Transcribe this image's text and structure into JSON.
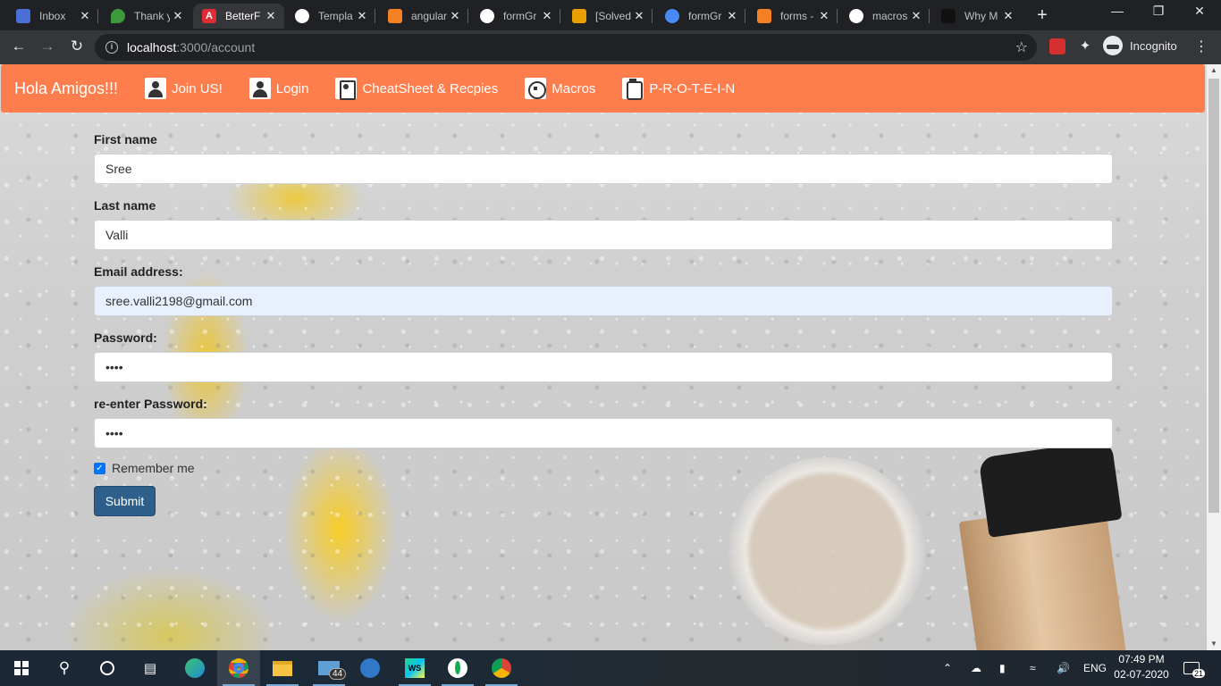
{
  "browser": {
    "tabs": [
      {
        "label": "Inbox",
        "color": "#4a6fd6"
      },
      {
        "label": "Thank y",
        "color": "#3c9a3c"
      },
      {
        "label": "BetterF",
        "color": "#dd2c35",
        "active": true
      },
      {
        "label": "Templa",
        "color": "#ffffff"
      },
      {
        "label": "angular",
        "color": "#f48024"
      },
      {
        "label": "formGr",
        "color": "#ffffff"
      },
      {
        "label": "[Solved",
        "color": "#e8a000"
      },
      {
        "label": "formGr",
        "color": "#4a8af4"
      },
      {
        "label": "forms -",
        "color": "#f48024"
      },
      {
        "label": "macros",
        "color": "#ffffff"
      },
      {
        "label": "Why M",
        "color": "#111111"
      }
    ],
    "url_host": "localhost",
    "url_path": ":3000/account",
    "incognito_label": "Incognito"
  },
  "navbar": {
    "brand": "Hola Amigos!!!",
    "items": [
      {
        "label": "Join US!",
        "icon": "user-icon"
      },
      {
        "label": "Login",
        "icon": "user-icon"
      },
      {
        "label": "CheatSheet & Recpies",
        "icon": "book-icon"
      },
      {
        "label": "Macros",
        "icon": "calculator-icon"
      },
      {
        "label": "P-R-O-T-E-I-N",
        "icon": "jar-icon"
      }
    ],
    "color": "#fe7d4c"
  },
  "form": {
    "first_name": {
      "label": "First name",
      "value": "Sree"
    },
    "last_name": {
      "label": "Last name",
      "value": "Valli"
    },
    "email": {
      "label": "Email address:",
      "value": "sree.valli2198@gmail.com"
    },
    "password": {
      "label": "Password:",
      "value": "••••"
    },
    "reenter_password": {
      "label": "re-enter Password:",
      "value": "••••"
    },
    "remember_label": "Remember me",
    "remember_checked": true,
    "submit_label": "Submit"
  },
  "taskbar": {
    "mail_badge": "44",
    "language": "ENG",
    "time": "07:49 PM",
    "date": "02-07-2020",
    "notification_count": "21"
  }
}
